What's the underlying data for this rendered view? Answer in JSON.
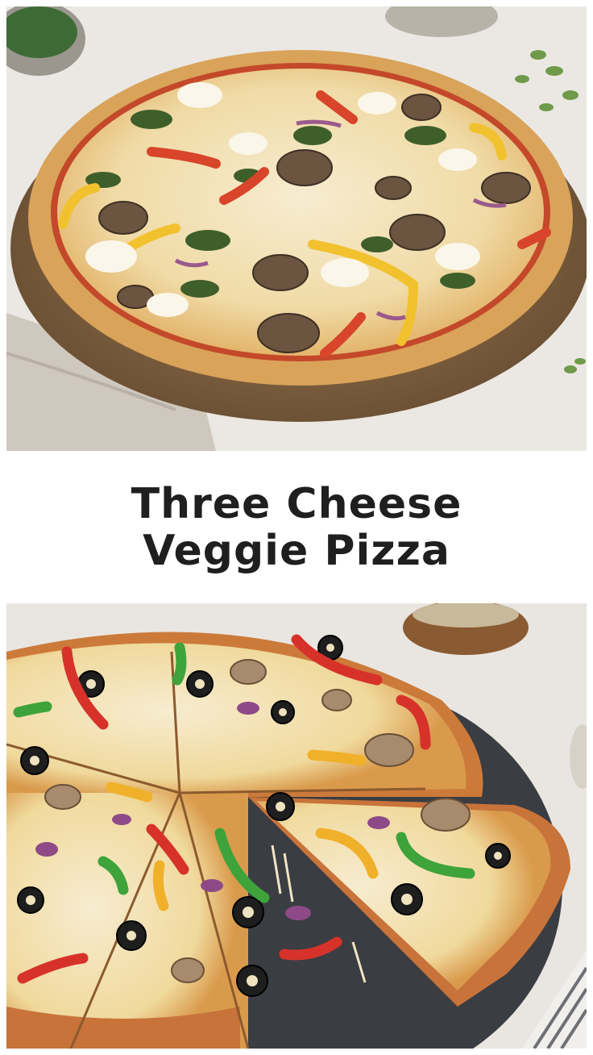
{
  "title": {
    "line1": "Three Cheese",
    "line2": "Veggie Pizza"
  },
  "images": {
    "top": {
      "icon": "whole-veggie-pizza-photo"
    },
    "bottom": {
      "icon": "sliced-veggie-pizza-photo"
    }
  },
  "colors": {
    "background": "#ffffff",
    "title": "#1f1f1f",
    "crust": "#d9a35a",
    "cheese": "#f4e6c0",
    "sauce": "#c4482a",
    "board": "#8a6a45",
    "slate": "#3a3d42"
  }
}
